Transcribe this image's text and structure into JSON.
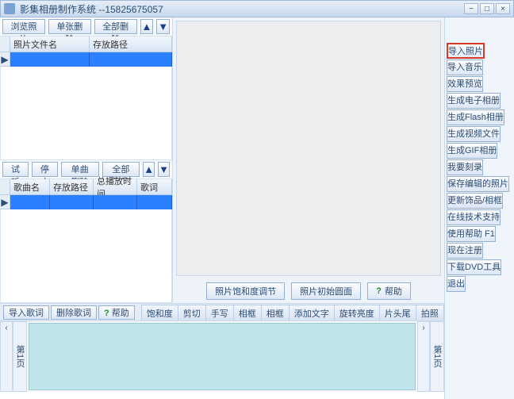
{
  "window": {
    "title": "影集相册制作系统 --15825675057",
    "min": "−",
    "max": "□",
    "close": "×"
  },
  "leftTop": {
    "btns": [
      "浏览照片",
      "单张删除",
      "全部删除"
    ],
    "headers": [
      "照片文件名",
      "存放路径"
    ]
  },
  "leftBottom": {
    "btns": [
      "试听",
      "停止",
      "单曲删除",
      "全部删除"
    ],
    "headers": [
      "歌曲名",
      "存放路径",
      "总播放时间",
      "歌词"
    ]
  },
  "preview": {
    "ctrl1": "照片饱和度调节",
    "ctrl2": "照片初始圆面",
    "help": "帮助"
  },
  "bottomBar": {
    "btns": [
      "导入歌词",
      "删除歌词"
    ],
    "help": "帮助",
    "tabs": [
      "饱和度",
      "剪切",
      "手写",
      "相框",
      "相框",
      "添加文字",
      "旋转亮度",
      "片头尾",
      "拍照"
    ]
  },
  "sidebar": {
    "items": [
      "导入照片",
      "导入音乐",
      "效果预览",
      "生成电子相册",
      "生成Flash相册",
      "生成视频文件",
      "生成GIF相册",
      "我要刻录",
      "保存编辑的照片",
      "更新饰品/相框",
      "在线技术支持",
      "使用帮助  F1",
      "现在注册",
      "下载DVD工具",
      "退出"
    ]
  },
  "strip": {
    "page": "第1页"
  },
  "arrows": {
    "up": "▲",
    "down": "▼",
    "left": "‹",
    "right": "›",
    "tri": "▶"
  }
}
